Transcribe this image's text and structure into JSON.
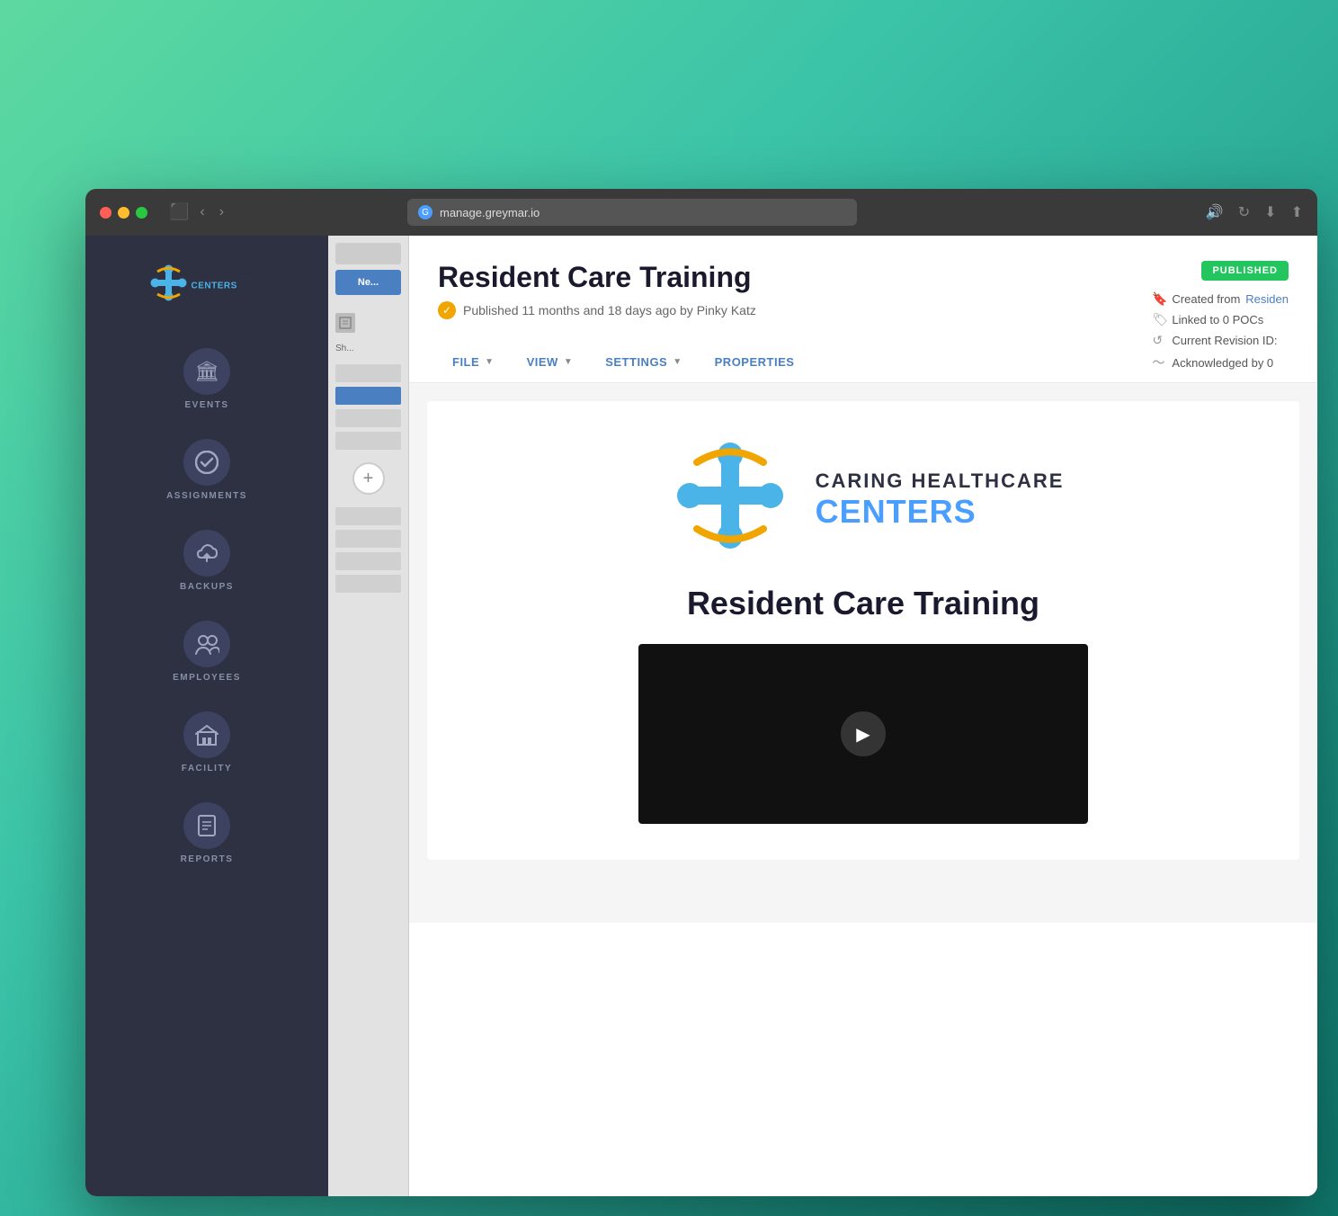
{
  "desktop": {
    "gradient_start": "#5dd9a0",
    "gradient_end": "#0f7a6e"
  },
  "browser": {
    "url": "manage.greymar.io",
    "favicon_text": "G"
  },
  "sidebar": {
    "logo_line1": "CARING HEALTHCARE",
    "logo_line2": "CENTERS",
    "nav_items": [
      {
        "id": "events",
        "label": "EVENTS",
        "icon": "🏛"
      },
      {
        "id": "assignments",
        "label": "ASSIGNMENTS",
        "icon": "✓"
      },
      {
        "id": "backups",
        "label": "BACKUPS",
        "icon": "⚡"
      },
      {
        "id": "employees",
        "label": "EMPLOYEES",
        "icon": "👥"
      },
      {
        "id": "facility",
        "label": "FACILITY",
        "icon": "🏢"
      },
      {
        "id": "reports",
        "label": "REPORTS",
        "icon": "📋"
      }
    ]
  },
  "document": {
    "title": "Resident Care Training",
    "subtitle": "Published 11 months and 18 days ago by Pinky Katz",
    "status_badge": "PUBLISHED",
    "meta": {
      "created_from_label": "Created from",
      "created_from_link": "Residen",
      "linked_to": "Linked to 0 POCs",
      "current_revision": "Current Revision ID:",
      "acknowledged_by": "Acknowledged by 0"
    },
    "toolbar": {
      "file_label": "FILE",
      "view_label": "VIEW",
      "settings_label": "SETTINGS",
      "properties_label": "PROPERTIES"
    },
    "card": {
      "company_line1": "CARING HEALTHCARE",
      "company_line2": "CENTERS",
      "training_title": "Resident Care Training"
    },
    "colors": {
      "published_badge": "#22c55e",
      "toolbar_text": "#4a7fc1",
      "title_color": "#1a1a2e"
    }
  }
}
